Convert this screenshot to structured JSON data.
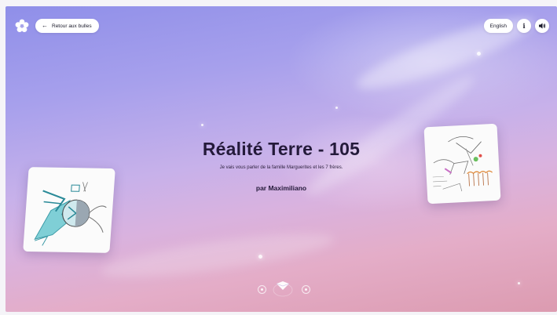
{
  "header": {
    "logo_icon": "flower-logo-icon",
    "back_label": "Retour aux bulles",
    "back_icon": "arrow-left-icon",
    "language_label": "English",
    "info_label": "i",
    "sound_icon": "speaker-icon"
  },
  "story": {
    "title": "Réalité Terre - 105",
    "description": "Je vais vous parler de la famille Marguerites et les 7 frères.",
    "author": "par Maximiliano"
  },
  "carousel": {
    "prev_icon": "circle-dot-prev-icon",
    "current_icon": "diamond-marker-icon",
    "next_icon": "circle-dot-next-icon"
  },
  "colors": {
    "accent": "#241a3a",
    "background_top": "#8f8fe9",
    "background_bottom": "#dc9bb0"
  }
}
